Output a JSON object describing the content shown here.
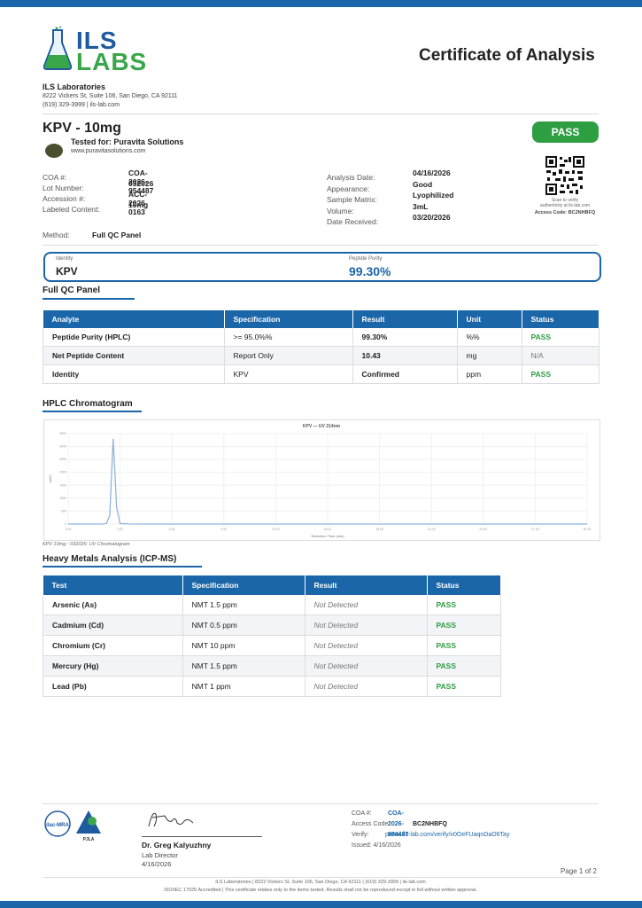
{
  "header": {
    "logo_top": "ILS",
    "logo_bottom": "LABS",
    "doc_title": "Certificate of Analysis",
    "lab_name": "ILS Laboratories",
    "address": "8222 Vickers St, Suite 106, San Diego, CA 92111",
    "contact": "(619) 329-3999  |  ils-lab.com"
  },
  "product": {
    "name": "KPV - 10mg",
    "tested_for": "Tested for: Puravita Solutions",
    "client_url": "www.puravitasolutions.com",
    "status": "PASS"
  },
  "meta_left": [
    {
      "label": "COA #:",
      "value": "COA-2026-954487"
    },
    {
      "label": "Lot Number:",
      "value": "032026"
    },
    {
      "label": "Accession #:",
      "value": "ACC-2026-0163"
    },
    {
      "label": "Labeled Content:",
      "value": "10mg"
    }
  ],
  "meta_right": [
    {
      "label": "Analysis Date:",
      "value": "04/16/2026"
    },
    {
      "label": "Appearance:",
      "value": "Good"
    },
    {
      "label": "Sample Matrix:",
      "value": "Lyophilized"
    },
    {
      "label": "Volume:",
      "value": "3mL"
    },
    {
      "label": "Date Received:",
      "value": "03/20/2026"
    }
  ],
  "qr": {
    "scan_text_1": "Scan to verify",
    "scan_text_2": "authenticity at ils-lab.com",
    "access_code": "Access Code:  BC2NHBFQ"
  },
  "method": {
    "label": "Method:",
    "value": "Full QC Panel"
  },
  "identity_box": {
    "identity_label": "Identity",
    "identity_value": "KPV",
    "purity_label": "Peptide Purity",
    "purity_value": "99.30%"
  },
  "qc_panel": {
    "title": "Full QC Panel",
    "headers": [
      "Analyte",
      "Specification",
      "Result",
      "Unit",
      "Status"
    ],
    "rows": [
      [
        "Peptide Purity (HPLC)",
        ">= 95.0%%",
        "99.30%",
        "%%",
        "PASS"
      ],
      [
        "Net Peptide Content",
        "Report Only",
        "10.43",
        "mg",
        "N/A"
      ],
      [
        "Identity",
        "KPV",
        "Confirmed",
        "ppm",
        "PASS"
      ]
    ]
  },
  "chromatogram": {
    "title": "HPLC Chromatogram",
    "caption": "KPV 10mg - 032026: UV Chromatogram",
    "plot_title": "KPV — UV 214nm"
  },
  "chart_data": {
    "type": "line",
    "title": "KPV — UV 214nm",
    "xlabel": "Retention Time (min)",
    "ylabel": "mAU",
    "series": [
      {
        "name": "",
        "x": [
          0,
          1.5,
          2.0,
          2.2,
          2.4,
          2.6,
          2.8,
          3.0,
          3.5,
          5,
          10,
          15,
          20,
          25,
          30
        ],
        "y": [
          0,
          0,
          2,
          20,
          320,
          3300,
          650,
          20,
          2,
          0,
          0,
          0,
          0,
          0,
          0
        ]
      }
    ],
    "ylim": [
      0,
      3500
    ],
    "xlim": [
      0,
      30
    ]
  },
  "heavy_metals": {
    "title": "Heavy Metals Analysis (ICP-MS)",
    "headers": [
      "Test",
      "Specification",
      "Result",
      "Status"
    ],
    "rows": [
      [
        "Arsenic (As)",
        "NMT 1.5 ppm",
        "Not Detected",
        "PASS"
      ],
      [
        "Cadmium (Cd)",
        "NMT 0.5 ppm",
        "Not Detected",
        "PASS"
      ],
      [
        "Chromium (Cr)",
        "NMT 10 ppm",
        "Not Detected",
        "PASS"
      ],
      [
        "Mercury (Hg)",
        "NMT 1.5 ppm",
        "Not Detected",
        "PASS"
      ],
      [
        "Lead (Pb)",
        "NMT 1 ppm",
        "Not Detected",
        "PASS"
      ]
    ]
  },
  "signature": {
    "name": "Dr. Greg Kalyuzhny",
    "title": "Lab Director",
    "date": "4/16/2026"
  },
  "verify": {
    "coa_label": "COA #:",
    "coa_value": "COA-2026-954487",
    "access_label": "Access Code:",
    "access_value": "BC2NHBFQ",
    "verify_label": "Verify:",
    "verify_value": "portal.ils-lab.com/verify/v0OeFUaqnDaO6Tay",
    "issued": "Issued: 4/16/2026"
  },
  "page": "Page 1 of 2",
  "footer": {
    "line1": "ILS Laboratories  |  8222 Vickers St, Suite 106, San Diego, CA 92111  |  (619) 329-3999  |  ils-lab.com",
    "line2": "ISO/IEC 17025 Accredited  |  This certificate relates only to the items tested. Results shall not be reproduced except in full without written approval."
  },
  "accreditation": {
    "ilac": "ilac-MRA",
    "pjla": "PJLA"
  }
}
